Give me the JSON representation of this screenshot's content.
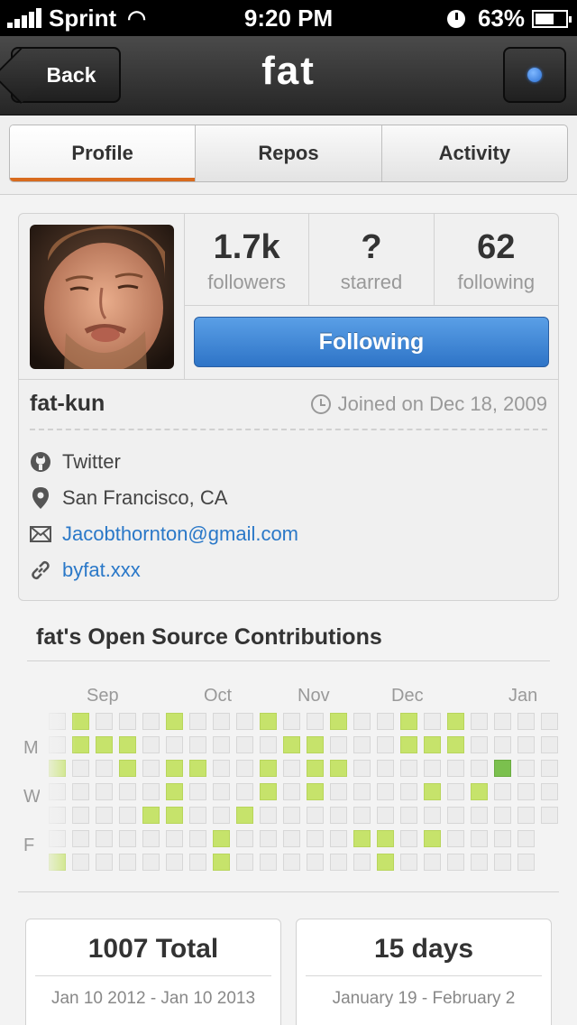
{
  "status": {
    "carrier": "Sprint",
    "time": "9:20 PM",
    "battery": "63%",
    "battery_level": 0.63
  },
  "nav": {
    "back_label": "Back",
    "title": "fat"
  },
  "tabs": [
    {
      "label": "Profile",
      "active": true
    },
    {
      "label": "Repos",
      "active": false
    },
    {
      "label": "Activity",
      "active": false
    }
  ],
  "profile": {
    "stats": [
      {
        "value": "1.7k",
        "label": "followers"
      },
      {
        "value": "?",
        "label": "starred"
      },
      {
        "value": "62",
        "label": "following"
      }
    ],
    "follow_label": "Following",
    "username": "fat-kun",
    "joined": "Joined on Dec 18, 2009",
    "twitter": "Twitter",
    "location": "San Francisco, CA",
    "email": "Jacobthornton@gmail.com",
    "website": "byfat.xxx"
  },
  "contributions": {
    "title": "fat's Open Source Contributions",
    "months": [
      "Sep",
      "Oct",
      "Nov",
      "Dec",
      "Jan"
    ],
    "days": [
      "M",
      "W",
      "F"
    ],
    "grid": [
      [
        0,
        1,
        0,
        0,
        0,
        1,
        0,
        0,
        0,
        1,
        0,
        0,
        1,
        0,
        0,
        1,
        0,
        1,
        0,
        0,
        0,
        0
      ],
      [
        0,
        1,
        1,
        1,
        0,
        0,
        0,
        0,
        0,
        0,
        1,
        1,
        0,
        0,
        0,
        1,
        1,
        1,
        0,
        0,
        0,
        0
      ],
      [
        1,
        0,
        0,
        1,
        0,
        1,
        1,
        0,
        0,
        1,
        0,
        1,
        1,
        0,
        0,
        0,
        0,
        0,
        0,
        2,
        0,
        0
      ],
      [
        0,
        0,
        0,
        0,
        0,
        1,
        0,
        0,
        0,
        1,
        0,
        1,
        0,
        0,
        0,
        0,
        1,
        0,
        1,
        0,
        0,
        0
      ],
      [
        0,
        0,
        0,
        0,
        1,
        1,
        0,
        0,
        1,
        0,
        0,
        0,
        0,
        0,
        0,
        0,
        0,
        0,
        0,
        0,
        0,
        0
      ],
      [
        0,
        0,
        0,
        0,
        0,
        0,
        0,
        1,
        0,
        0,
        0,
        0,
        0,
        1,
        1,
        0,
        1,
        0,
        0,
        0,
        0
      ],
      [
        1,
        0,
        0,
        0,
        0,
        0,
        0,
        1,
        0,
        0,
        0,
        0,
        0,
        0,
        1,
        0,
        0,
        0,
        0,
        0,
        0
      ]
    ]
  },
  "summary": [
    {
      "big": "1007 Total",
      "small": "Jan 10 2012 - Jan 10 2013"
    },
    {
      "big": "15 days",
      "small": "January 19 - February 2"
    }
  ]
}
